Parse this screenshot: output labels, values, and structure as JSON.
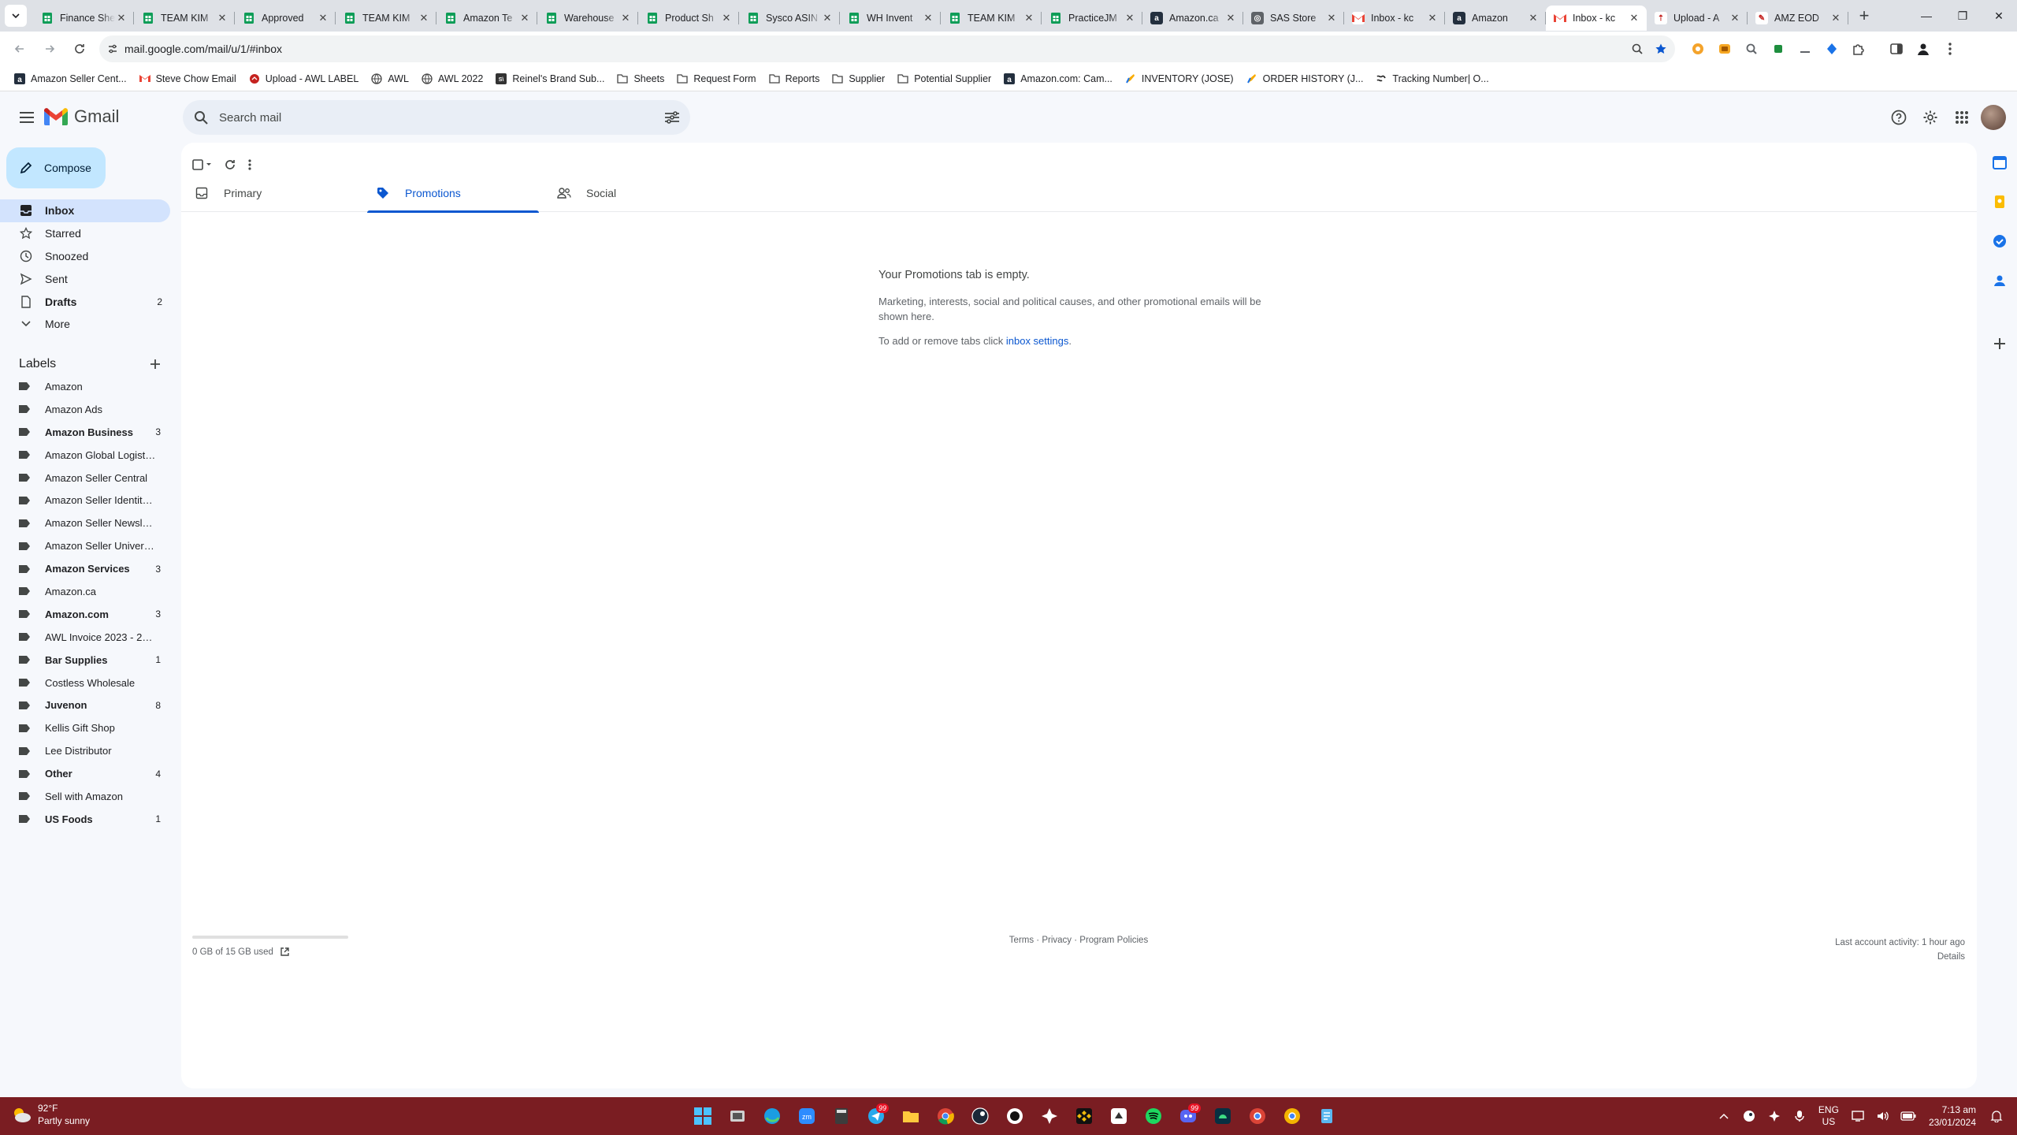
{
  "browser": {
    "tabs": [
      {
        "title": "Finance Sheet",
        "icon": "sheets-icon",
        "color": "#0f9d58",
        "glyph": ""
      },
      {
        "title": "TEAM KIM",
        "icon": "sheets-icon",
        "color": "#0f9d58",
        "glyph": ""
      },
      {
        "title": "Approved",
        "icon": "sheets-icon",
        "color": "#0f9d58",
        "glyph": ""
      },
      {
        "title": "TEAM KIM",
        "icon": "sheets-icon",
        "color": "#0f9d58",
        "glyph": ""
      },
      {
        "title": "Amazon Te",
        "icon": "sheets-icon",
        "color": "#0f9d58",
        "glyph": ""
      },
      {
        "title": "Warehouse",
        "icon": "sheets-icon",
        "color": "#0f9d58",
        "glyph": ""
      },
      {
        "title": "Product Sh",
        "icon": "sheets-icon",
        "color": "#0f9d58",
        "glyph": ""
      },
      {
        "title": "Sysco ASIN",
        "icon": "sheets-icon",
        "color": "#0f9d58",
        "glyph": ""
      },
      {
        "title": "WH Invent",
        "icon": "sheets-icon",
        "color": "#0f9d58",
        "glyph": ""
      },
      {
        "title": "TEAM KIM",
        "icon": "sheets-icon",
        "color": "#0f9d58",
        "glyph": ""
      },
      {
        "title": "PracticeJM",
        "icon": "sheets-icon",
        "color": "#0f9d58",
        "glyph": ""
      },
      {
        "title": "Amazon.ca",
        "icon": "amazon-icon",
        "color": "#232f3e",
        "glyph": "a"
      },
      {
        "title": "SAS Store",
        "icon": "store-icon",
        "color": "#5f6368",
        "glyph": "◎"
      },
      {
        "title": "Inbox - kc",
        "icon": "gmail-icon",
        "color": "#ffffff",
        "glyph": "M"
      },
      {
        "title": "Amazon",
        "icon": "amazon-icon",
        "color": "#232f3e",
        "glyph": "a"
      },
      {
        "title": "Inbox - kc",
        "icon": "gmail-icon",
        "color": "#ffffff",
        "glyph": "M"
      },
      {
        "title": "Upload - A",
        "icon": "upload-icon",
        "color": "#ffffff",
        "glyph": "⇡"
      },
      {
        "title": "AMZ EOD",
        "icon": "paint-icon",
        "color": "#ffffff",
        "glyph": "✎"
      }
    ],
    "active_tab_index": 15,
    "url": "mail.google.com/mail/u/1/#inbox",
    "bookmarks": [
      {
        "label": "Amazon Seller Cent...",
        "icon": "amazon-icon"
      },
      {
        "label": "Steve Chow Email",
        "icon": "gmail-icon"
      },
      {
        "label": "Upload - AWL LABEL",
        "icon": "upload-icon"
      },
      {
        "label": "AWL",
        "icon": "globe-icon"
      },
      {
        "label": "AWL 2022",
        "icon": "globe-icon"
      },
      {
        "label": "Reinel's Brand Sub...",
        "icon": "doc-icon"
      },
      {
        "label": "Sheets",
        "icon": "folder-icon"
      },
      {
        "label": "Request Form",
        "icon": "folder-icon"
      },
      {
        "label": "Reports",
        "icon": "folder-icon"
      },
      {
        "label": "Supplier",
        "icon": "folder-icon"
      },
      {
        "label": "Potential Supplier",
        "icon": "folder-icon"
      },
      {
        "label": "Amazon.com: Cam...",
        "icon": "amazon-icon"
      },
      {
        "label": "INVENTORY (JOSE)",
        "icon": "paint-icon"
      },
      {
        "label": "ORDER HISTORY (J...",
        "icon": "paint-icon"
      },
      {
        "label": "Tracking Number| O...",
        "icon": "script-icon"
      }
    ]
  },
  "gmail": {
    "brand": "Gmail",
    "search_placeholder": "Search mail",
    "compose_label": "Compose",
    "nav": [
      {
        "label": "Inbox",
        "count": "",
        "icon": "inbox-icon",
        "active": true,
        "name": "inbox"
      },
      {
        "label": "Starred",
        "count": "",
        "icon": "star-icon",
        "active": false,
        "name": "starred"
      },
      {
        "label": "Snoozed",
        "count": "",
        "icon": "clock-icon",
        "active": false,
        "name": "snoozed"
      },
      {
        "label": "Sent",
        "count": "",
        "icon": "send-icon",
        "active": false,
        "name": "sent"
      },
      {
        "label": "Drafts",
        "count": "2",
        "icon": "draft-icon",
        "active": false,
        "bold": true,
        "name": "drafts"
      },
      {
        "label": "More",
        "count": "",
        "icon": "chevron-down-icon",
        "active": false,
        "name": "more"
      }
    ],
    "labels_title": "Labels",
    "labels": [
      {
        "label": "Amazon",
        "count": "",
        "bold": false
      },
      {
        "label": "Amazon Ads",
        "count": "",
        "bold": false
      },
      {
        "label": "Amazon Business",
        "count": "3",
        "bold": true
      },
      {
        "label": "Amazon Global Logistics",
        "count": "",
        "bold": false
      },
      {
        "label": "Amazon Seller Central",
        "count": "",
        "bold": false
      },
      {
        "label": "Amazon Seller Identity V...",
        "count": "",
        "bold": false
      },
      {
        "label": "Amazon Seller Newsletter",
        "count": "",
        "bold": false
      },
      {
        "label": "Amazon Seller University",
        "count": "",
        "bold": false
      },
      {
        "label": "Amazon Services",
        "count": "3",
        "bold": true
      },
      {
        "label": "Amazon.ca",
        "count": "",
        "bold": false
      },
      {
        "label": "Amazon.com",
        "count": "3",
        "bold": true
      },
      {
        "label": "AWL Invoice 2023 - 2024",
        "count": "",
        "bold": false
      },
      {
        "label": "Bar Supplies",
        "count": "1",
        "bold": true
      },
      {
        "label": "Costless Wholesale",
        "count": "",
        "bold": false
      },
      {
        "label": "Juvenon",
        "count": "8",
        "bold": true
      },
      {
        "label": "Kellis Gift Shop",
        "count": "",
        "bold": false
      },
      {
        "label": "Lee Distributor",
        "count": "",
        "bold": false
      },
      {
        "label": "Other",
        "count": "4",
        "bold": true
      },
      {
        "label": "Sell with Amazon",
        "count": "",
        "bold": false
      },
      {
        "label": "US Foods",
        "count": "1",
        "bold": true
      }
    ],
    "category_tabs": [
      {
        "label": "Primary",
        "icon": "inbox-tray-icon",
        "active": false
      },
      {
        "label": "Promotions",
        "icon": "tag-icon",
        "active": true
      },
      {
        "label": "Social",
        "icon": "people-icon",
        "active": false
      }
    ],
    "empty_state": {
      "heading": "Your Promotions tab is empty.",
      "body": "Marketing, interests, social and political causes, and other promotional emails will be shown here.",
      "settings_prefix": "To add or remove tabs click ",
      "settings_link": "inbox settings",
      "settings_suffix": "."
    },
    "footer": {
      "storage": "0 GB of 15 GB used",
      "storage_fraction": 0.0,
      "links": [
        "Terms",
        "Privacy",
        "Program Policies"
      ],
      "separator": " · ",
      "activity": "Last account activity: 1 hour ago",
      "details": "Details"
    }
  },
  "taskbar": {
    "weather_temp": "92°F",
    "weather_desc": "Partly sunny",
    "language": "ENG",
    "region": "US",
    "time": "7:13 am",
    "date": "23/01/2024",
    "telegram_badge": "99",
    "discord_badge": "99"
  },
  "colors": {
    "accent": "#0b57d0",
    "compose_bg": "#c2e7ff",
    "active_nav": "#d3e3fd",
    "taskbar": "#7a1d22"
  }
}
